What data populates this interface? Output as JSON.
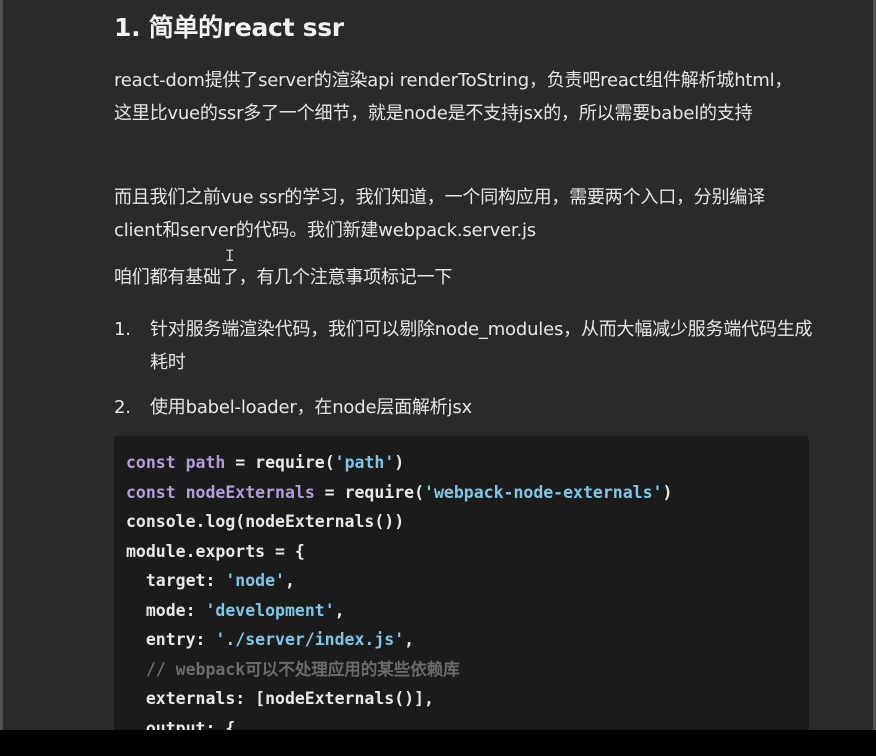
{
  "article": {
    "title": "1. 简单的react ssr",
    "paragraph1": "react-dom提供了server的渲染api renderToString，负责吧react组件解析城html， 这里比vue的ssr多了一个细节，就是node是不支持jsx的，所以需要babel的支持",
    "paragraph2": "而且我们之前vue ssr的学习，我们知道，一个同构应用，需要两个入口，分别编译client和server的代码。我们新建webpack.server.js",
    "paragraph3": "咱们都有基础了，有几个注意事项标记一下",
    "list": [
      {
        "num": "1.",
        "text": "针对服务端渲染代码，我们可以剔除node_modules，从而大幅减少服务端代码生成耗时"
      },
      {
        "num": "2.",
        "text": "使用babel-loader，在node层面解析jsx"
      }
    ]
  },
  "code": {
    "line1": {
      "kw": "const",
      "name": "path",
      "op": " = ",
      "fn": "require(",
      "str": "'path'",
      "end": ")"
    },
    "line2": {
      "kw": "const",
      "name": "nodeExternals",
      "op": " = ",
      "fn": "require(",
      "str": "'webpack-node-externals'",
      "end": ")"
    },
    "line3": "console.log(nodeExternals())",
    "line4": "module.exports = {",
    "line5": {
      "key": "  target: ",
      "str": "'node'",
      "end": ","
    },
    "line6": {
      "key": "  mode: ",
      "str": "'development'",
      "end": ","
    },
    "line7": {
      "key": "  entry: ",
      "str": "'./server/index.js'",
      "end": ","
    },
    "line8": "  // webpack可以不处理应用的某些依赖库",
    "line9": "  externals: [nodeExternals()],",
    "line10": "  output: {"
  },
  "colors": {
    "background": "#2a2a2a",
    "code_background": "#1b1b1b",
    "keyword": "#b39ddb",
    "string": "#7ec7e8",
    "comment": "#6b6b6b",
    "text": "#e6e6e6"
  },
  "cursor_glyph": "I"
}
